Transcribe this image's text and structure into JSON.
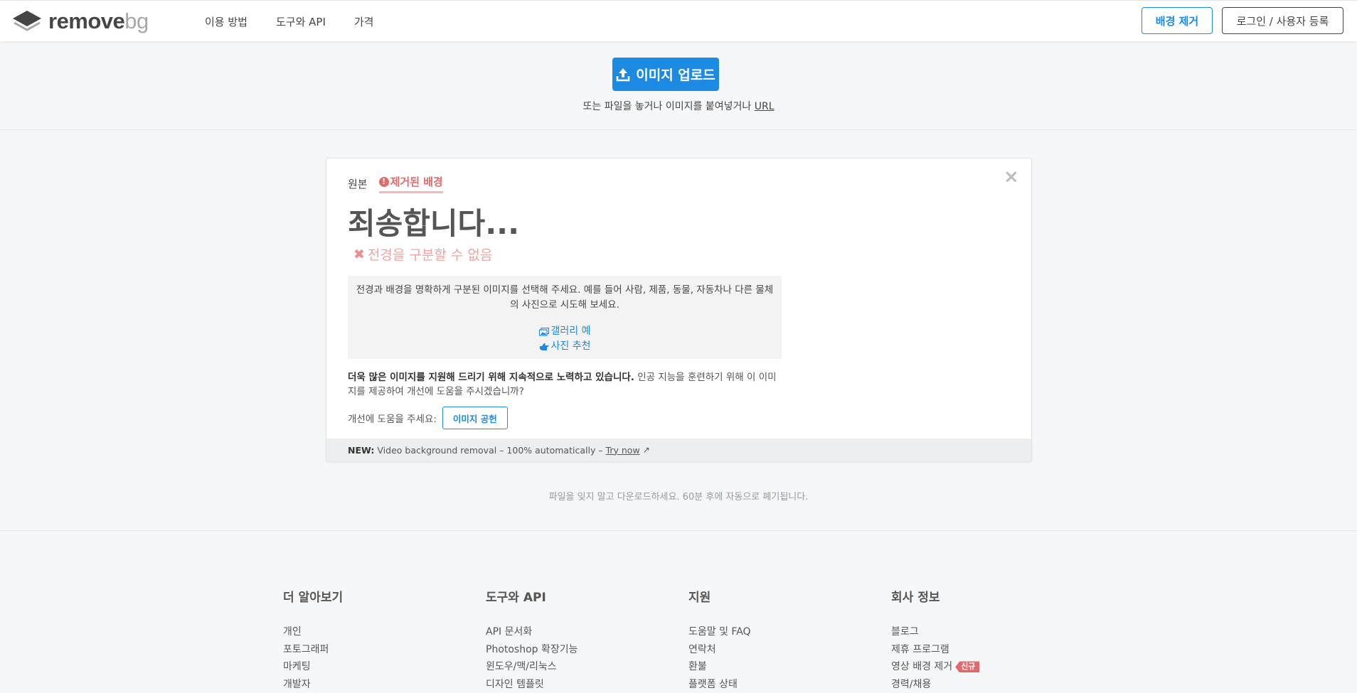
{
  "brand": {
    "word1": "remove",
    "word2": "bg"
  },
  "nav": [
    {
      "label": "이용 방법"
    },
    {
      "label": "도구와 API"
    },
    {
      "label": "가격"
    }
  ],
  "header_buttons": {
    "remove_bg": "배경 제거",
    "login": "로그인 / 사용자 등록"
  },
  "upload": {
    "button_label": "이미지 업로드",
    "hint_prefix": "또는 파일을 놓거나 이미지를 붙여넣거나",
    "hint_url": "URL"
  },
  "result": {
    "tab_original": "원본",
    "tab_removed": "제거된 배경",
    "close": "×",
    "sorry": "죄송합니다...",
    "error": "전경을 구분할 수 없음",
    "hint_text": "전경과 배경을 명확하게 구분된 이미지를 선택해 주세요. 예를 들어 사람, 제품, 동물, 자동차나 다른 물체의 사진으로 시도해 보세요.",
    "link_gallery": "갤러리 예",
    "link_recommend": "사진 추천",
    "help_bold": "더욱 많은 이미지를 지원해 드리기 위해 지속적으로 노력하고 있습니다.",
    "help_rest": " 인공 지능을 훈련하기 위해 이 이미지를 제공하여 개선에 도움을 주시겠습니까?",
    "donate_label": "개선에 도움을 주세요:",
    "donate_button": "이미지 공헌",
    "foot_new": "NEW:",
    "foot_text": "Video background removal – 100% automatically –",
    "foot_try": "Try now"
  },
  "remind": "파일을 잊지 말고 다운로드하세요. 60분 후에 자동으로 폐기됩니다.",
  "footer": {
    "columns": [
      {
        "title": "더 알아보기",
        "items": [
          "개인",
          "포토그래퍼",
          "마케팅",
          "개발자"
        ]
      },
      {
        "title": "도구와 API",
        "items": [
          "API 문서화",
          "Photoshop 확장기능",
          "윈도우/맥/리눅스",
          "디자인 템플릿"
        ]
      },
      {
        "title": "지원",
        "items": [
          "도움말 및 FAQ",
          "연락처",
          "환불",
          "플랫폼 상태"
        ]
      },
      {
        "title": "회사 정보",
        "items": [
          "블로그",
          "제휴 프로그램",
          "영상 배경 제거",
          "경력/채용"
        ]
      }
    ],
    "new_badge": "신규"
  },
  "colors": {
    "accent": "#1c8ae3",
    "error": "#e06b6b",
    "background": "#f6f7f8"
  }
}
